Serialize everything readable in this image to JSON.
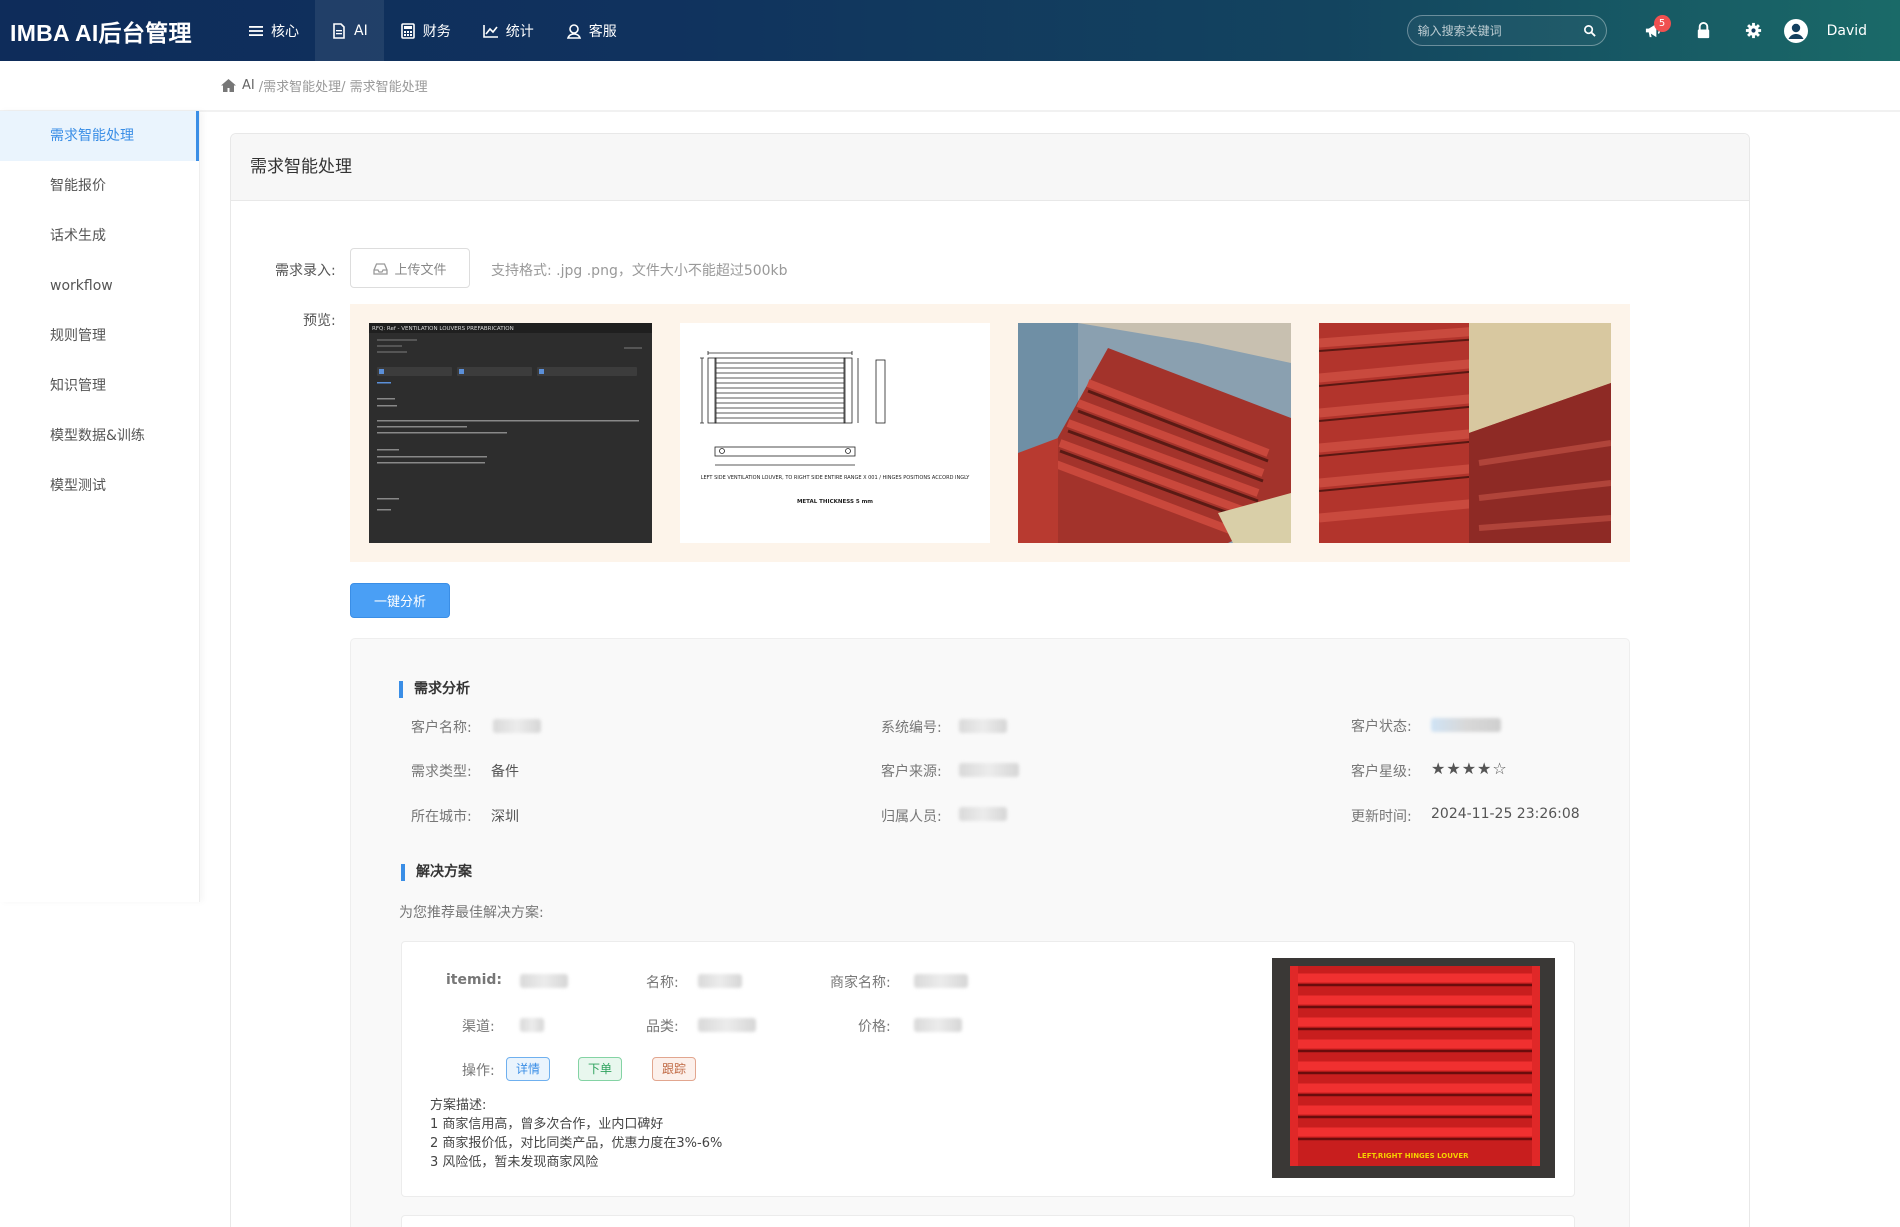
{
  "brand": "IMBA AI后台管理",
  "nav": [
    {
      "label": "核心",
      "icon": "menu-icon"
    },
    {
      "label": "AI",
      "icon": "document-icon"
    },
    {
      "label": "财务",
      "icon": "calculator-icon"
    },
    {
      "label": "统计",
      "icon": "chart-icon"
    },
    {
      "label": "客服",
      "icon": "support-icon"
    }
  ],
  "search": {
    "placeholder": "输入搜索关键词"
  },
  "notifications": {
    "count": "5"
  },
  "user": {
    "name": "David"
  },
  "breadcrumb": {
    "home": "AI",
    "path": "/需求智能处理/ 需求智能处理"
  },
  "sidebar": {
    "items": [
      {
        "label": "需求智能处理",
        "active": true
      },
      {
        "label": "智能报价"
      },
      {
        "label": "话术生成"
      },
      {
        "label": "workflow"
      },
      {
        "label": "规则管理"
      },
      {
        "label": "知识管理"
      },
      {
        "label": "模型数据&训练"
      },
      {
        "label": "模型测试"
      }
    ]
  },
  "panel": {
    "title": "需求智能处理",
    "input_label": "需求录入:",
    "upload_label": "上传文件",
    "upload_hint": "支持格式: .jpg .png，文件大小不能超过500kb",
    "preview_label": "预览:",
    "analyze_button": "一键分析"
  },
  "previews": {
    "email_subject": "RFQ: Ref            - VENTILATION LOUVERS PREFABRICATION",
    "drawing_caption": "LEFT SIDE VENTILATION LOUVER, TO RIGHT SIDE ENTIRE RANGE X 001 / HINGES POSITIONS ACCORD INGLY",
    "drawing_thickness": "METAL THICKNESS 5 mm"
  },
  "analysis": {
    "title": "需求分析",
    "fields": {
      "customer_name_label": "客户名称:",
      "system_id_label": "系统编号:",
      "customer_status_label": "客户状态:",
      "demand_type_label": "需求类型:",
      "demand_type_value": "备件",
      "customer_source_label": "客户来源:",
      "customer_rating_label": "客户星级:",
      "customer_rating_stars": "★★★★☆",
      "city_label": "所在城市:",
      "city_value": "深圳",
      "owner_label": "归属人员:",
      "updated_label": "更新时间:",
      "updated_value": "2024-11-25 23:26:08"
    }
  },
  "solution": {
    "title": "解决方案",
    "subtitle": "为您推荐最佳解决方案:",
    "itemid_label": "itemid:",
    "name_label": "名称:",
    "merchant_label": "商家名称:",
    "channel_label": "渠道:",
    "category_label": "品类:",
    "price_label": "价格:",
    "action_label": "操作:",
    "actions": {
      "detail": "详情",
      "order": "下单",
      "track": "跟踪"
    },
    "desc_title": "方案描述:",
    "desc_lines": [
      "1 商家信用高，曾多次合作，业内口碑好",
      "2 商家报价低，对比同类产品，优惠力度在3%-6%",
      "3 风险低，暂未发现商家风险"
    ],
    "product_image_caption": "LEFT,RIGHT HINGES LOUVER"
  }
}
